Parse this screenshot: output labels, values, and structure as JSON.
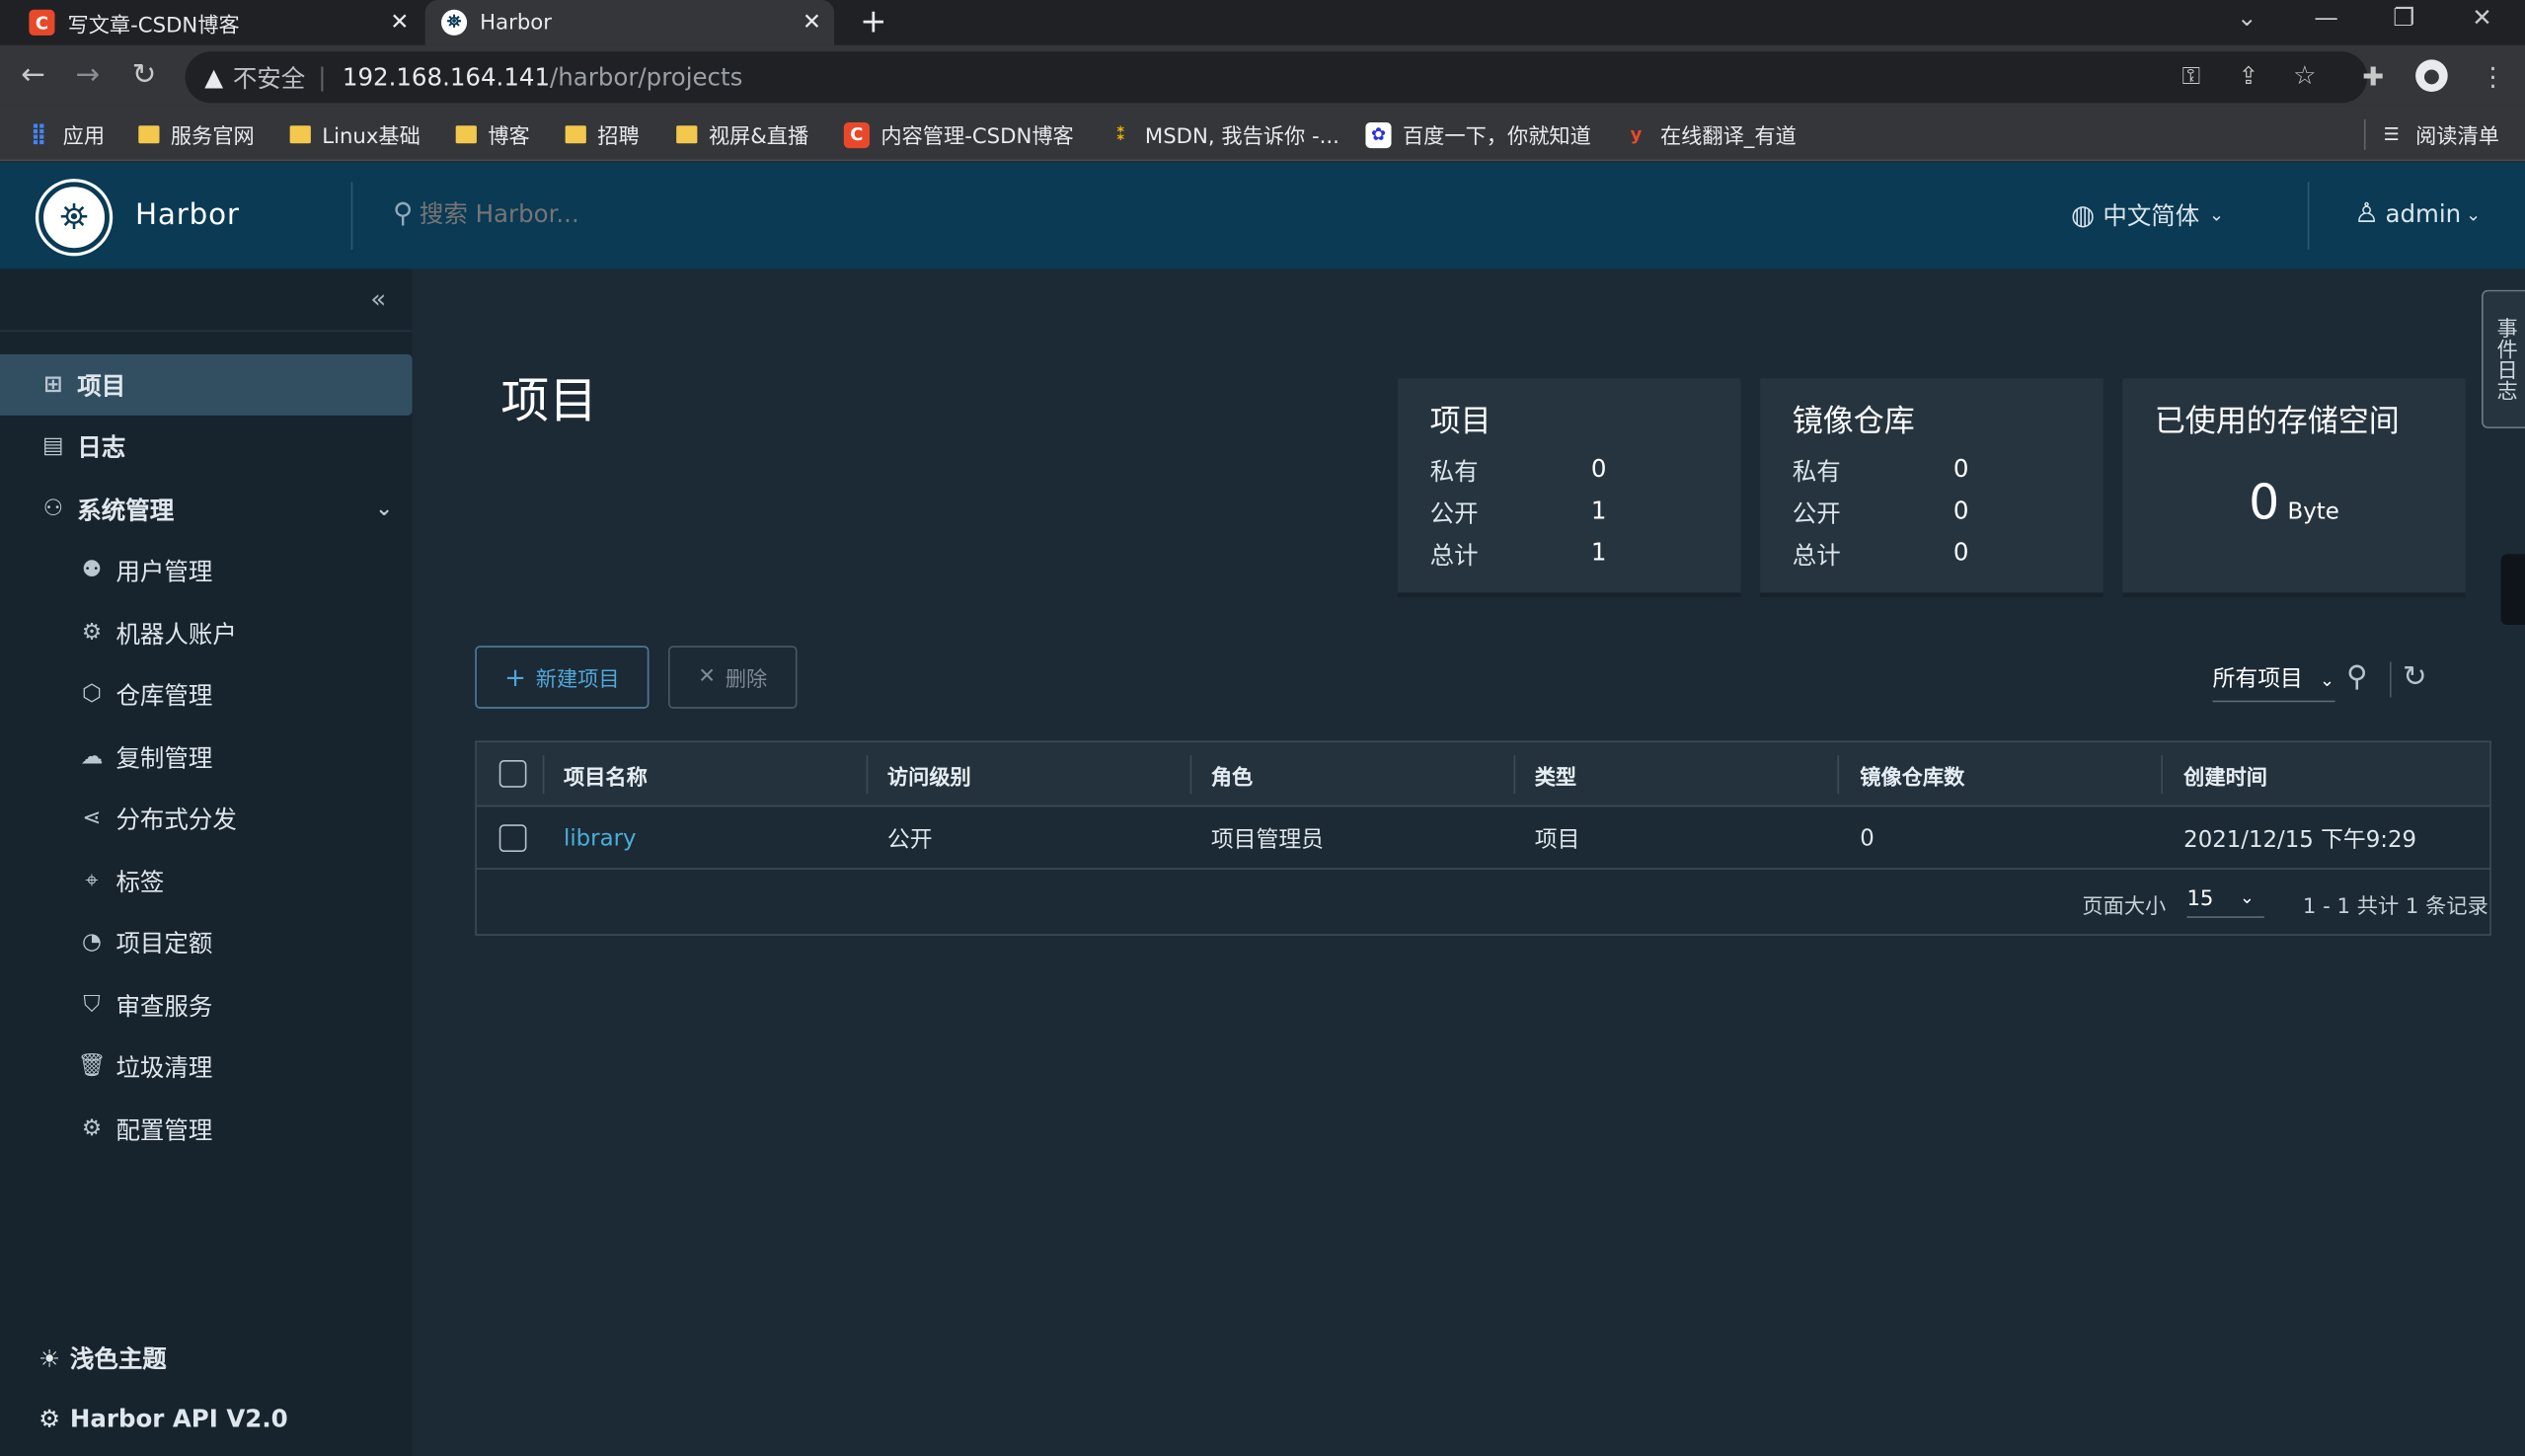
{
  "browser": {
    "tabs": [
      {
        "title": "写文章-CSDN博客",
        "favicon": "C",
        "favicon_color": "#e8492b"
      },
      {
        "title": "Harbor",
        "favicon": "harbor-logo"
      }
    ],
    "new_tab": "+",
    "address": {
      "warning_icon": "▲",
      "insecure_label": "不安全",
      "host": "192.168.164.141",
      "path": "/harbor/projects"
    },
    "bookmarks": [
      {
        "label": "应用",
        "icon": "apps-grid-icon"
      },
      {
        "label": "服务官网",
        "icon": "folder-icon"
      },
      {
        "label": "Linux基础",
        "icon": "folder-icon"
      },
      {
        "label": "博客",
        "icon": "folder-icon"
      },
      {
        "label": "招聘",
        "icon": "folder-icon"
      },
      {
        "label": "视屏&直播",
        "icon": "folder-icon"
      },
      {
        "label": "内容管理-CSDN博客",
        "icon": "csdn-icon"
      },
      {
        "label": "MSDN, 我告诉你 -...",
        "icon": "msdn-icon"
      },
      {
        "label": "百度一下，你就知道",
        "icon": "baidu-icon"
      },
      {
        "label": "在线翻译_有道",
        "icon": "youdao-icon"
      }
    ],
    "reading_list": "阅读清单"
  },
  "header": {
    "app_name": "Harbor",
    "search_placeholder": "搜索 Harbor...",
    "language": "中文简体",
    "user": "admin"
  },
  "sidebar": {
    "items": [
      {
        "label": "项目",
        "icon": "project-icon",
        "active": true
      },
      {
        "label": "日志",
        "icon": "log-icon"
      },
      {
        "label": "系统管理",
        "icon": "admin-icon",
        "expandable": true
      },
      {
        "label": "用户管理",
        "icon": "users-icon"
      },
      {
        "label": "机器人账户",
        "icon": "robot-icon"
      },
      {
        "label": "仓库管理",
        "icon": "registry-icon"
      },
      {
        "label": "复制管理",
        "icon": "replication-icon"
      },
      {
        "label": "分布式分发",
        "icon": "distribution-icon"
      },
      {
        "label": "标签",
        "icon": "tag-icon"
      },
      {
        "label": "项目定额",
        "icon": "quota-icon"
      },
      {
        "label": "审查服务",
        "icon": "shield-icon"
      },
      {
        "label": "垃圾清理",
        "icon": "trash-icon"
      },
      {
        "label": "配置管理",
        "icon": "gear-icon"
      }
    ],
    "theme": "浅色主题",
    "api": "Harbor API V2.0"
  },
  "main": {
    "title": "项目",
    "cards": {
      "projects": {
        "title": "项目",
        "rows": [
          {
            "label": "私有",
            "value": "0"
          },
          {
            "label": "公开",
            "value": "1"
          },
          {
            "label": "总计",
            "value": "1"
          }
        ]
      },
      "repos": {
        "title": "镜像仓库",
        "rows": [
          {
            "label": "私有",
            "value": "0"
          },
          {
            "label": "公开",
            "value": "0"
          },
          {
            "label": "总计",
            "value": "0"
          }
        ]
      },
      "storage": {
        "title": "已使用的存储空间",
        "value": "0",
        "unit": "Byte"
      }
    },
    "new_project_label": "新建项目",
    "delete_label": "删除",
    "filter_label": "所有项目",
    "table": {
      "columns": [
        "项目名称",
        "访问级别",
        "角色",
        "类型",
        "镜像仓库数",
        "创建时间"
      ],
      "rows": [
        {
          "name": "library",
          "access": "公开",
          "role": "项目管理员",
          "type": "项目",
          "repo_count": "0",
          "created": "2021/12/15 下午9:29"
        }
      ],
      "page_size_label": "页面大小",
      "page_size": "15",
      "summary": "1 - 1 共计 1 条记录"
    },
    "event_tab": "事件日志"
  }
}
